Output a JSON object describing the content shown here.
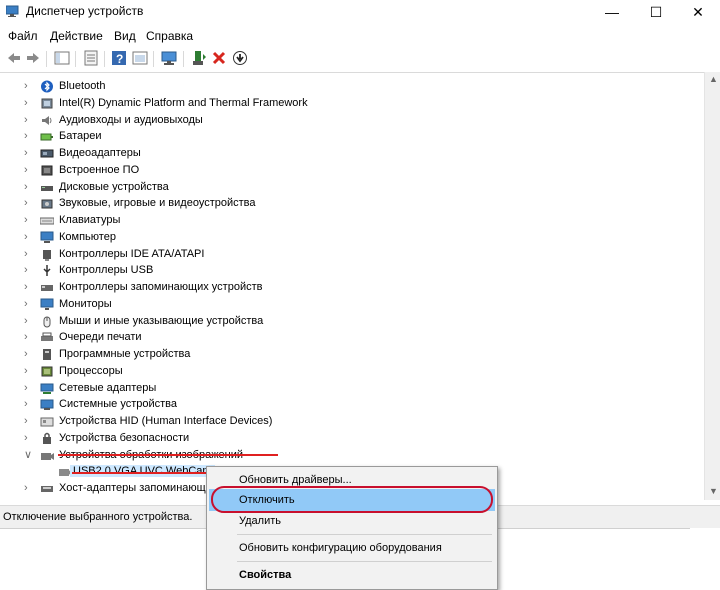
{
  "window": {
    "title": "Диспетчер устройств"
  },
  "menu": [
    "Файл",
    "Действие",
    "Вид",
    "Справка"
  ],
  "tree": {
    "categories": [
      {
        "label": "Bluetooth",
        "icon": "bluetooth-icon"
      },
      {
        "label": "Intel(R) Dynamic Platform and Thermal Framework",
        "icon": "chip-icon"
      },
      {
        "label": "Аудиовходы и аудиовыходы",
        "icon": "speaker-icon"
      },
      {
        "label": "Батареи",
        "icon": "battery-icon"
      },
      {
        "label": "Видеоадаптеры",
        "icon": "display-adapter-icon"
      },
      {
        "label": "Встроенное ПО",
        "icon": "firmware-icon"
      },
      {
        "label": "Дисковые устройства",
        "icon": "disk-icon"
      },
      {
        "label": "Звуковые, игровые и видеоустройства",
        "icon": "sound-icon"
      },
      {
        "label": "Клавиатуры",
        "icon": "keyboard-icon"
      },
      {
        "label": "Компьютер",
        "icon": "computer-icon"
      },
      {
        "label": "Контроллеры IDE ATA/ATAPI",
        "icon": "ide-controller-icon"
      },
      {
        "label": "Контроллеры USB",
        "icon": "usb-icon"
      },
      {
        "label": "Контроллеры запоминающих устройств",
        "icon": "storage-controller-icon"
      },
      {
        "label": "Мониторы",
        "icon": "monitor-icon"
      },
      {
        "label": "Мыши и иные указывающие устройства",
        "icon": "mouse-icon"
      },
      {
        "label": "Очереди печати",
        "icon": "printer-icon"
      },
      {
        "label": "Программные устройства",
        "icon": "software-device-icon"
      },
      {
        "label": "Процессоры",
        "icon": "processor-icon"
      },
      {
        "label": "Сетевые адаптеры",
        "icon": "network-adapter-icon"
      },
      {
        "label": "Системные устройства",
        "icon": "system-device-icon"
      },
      {
        "label": "Устройства HID (Human Interface Devices)",
        "icon": "hid-icon"
      },
      {
        "label": "Устройства безопасности",
        "icon": "security-device-icon"
      },
      {
        "label": "Устройства обработки изображений",
        "icon": "camera-icon",
        "expanded": true
      },
      {
        "label": "Хост-адаптеры запоминающ",
        "icon": "host-adapter-icon"
      }
    ],
    "child": {
      "label": "USB2.0 VGA UVC WebCam",
      "icon": "webcam-icon"
    }
  },
  "context_menu": {
    "items": [
      "Обновить драйверы...",
      "Отключить",
      "Удалить",
      "Обновить конфигурацию оборудования",
      "Свойства"
    ]
  },
  "status": {
    "text": "Отключение выбранного устройства."
  },
  "colors": {
    "highlight": "#91c9f7",
    "selection": "#cde8ff",
    "annotation_red": "#c8102e"
  }
}
